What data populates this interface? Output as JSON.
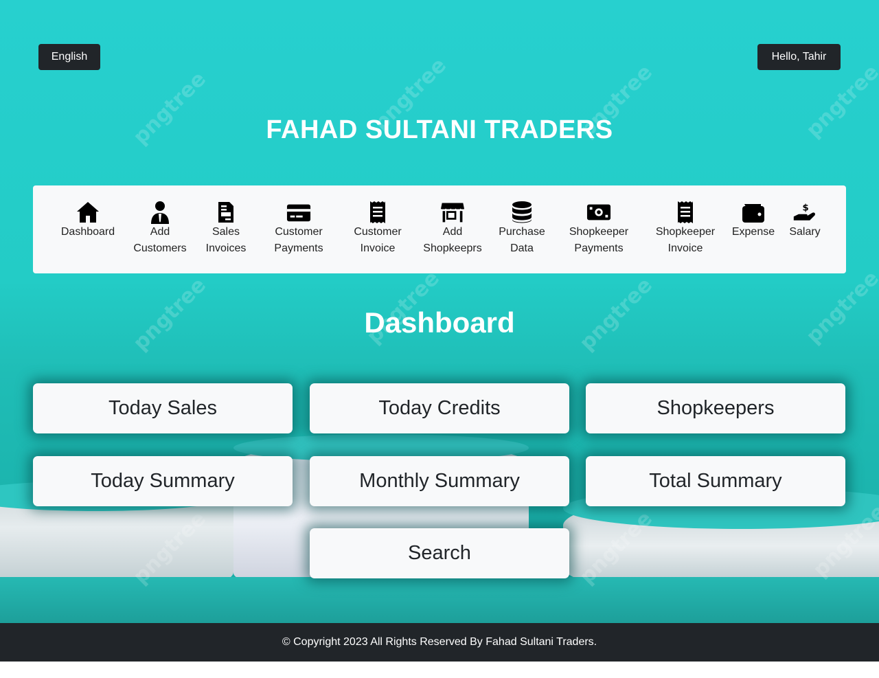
{
  "header": {
    "language_label": "English",
    "greeting": "Hello, Tahir",
    "brand_title": "FAHAD SULTANI TRADERS"
  },
  "nav": {
    "items": [
      {
        "line1": "Dashboard",
        "line2": "",
        "icon": "home-icon"
      },
      {
        "line1": "Add",
        "line2": "Customers",
        "icon": "user-icon"
      },
      {
        "line1": "Sales",
        "line2": "Invoices",
        "icon": "file-invoice-icon"
      },
      {
        "line1": "Customer",
        "line2": "Payments",
        "icon": "credit-card-icon"
      },
      {
        "line1": "Customer",
        "line2": "Invoice",
        "icon": "receipt-icon"
      },
      {
        "line1": "Add",
        "line2": "Shopkeeprs",
        "icon": "store-icon"
      },
      {
        "line1": "Purchase",
        "line2": "Data",
        "icon": "database-icon"
      },
      {
        "line1": "Shopkeeper",
        "line2": "Payments",
        "icon": "money-bill-icon"
      },
      {
        "line1": "Shopkeeper",
        "line2": "Invoice",
        "icon": "receipt-icon"
      },
      {
        "line1": "Expense",
        "line2": "",
        "icon": "wallet-icon"
      },
      {
        "line1": "Salary",
        "line2": "",
        "icon": "hand-dollar-icon"
      }
    ]
  },
  "main": {
    "title": "Dashboard",
    "buttons": [
      "Today Sales",
      "Today Credits",
      "Shopkeepers",
      "Today Summary",
      "Monthly Summary",
      "Total Summary",
      "Search"
    ]
  },
  "footer": {
    "copyright": "© Copyright 2023 All Rights Reserved By Fahad Sultani Traders."
  },
  "background": {
    "watermark_text": "pngtree",
    "accent_color": "#23ccc6",
    "dark_color": "#212529"
  }
}
